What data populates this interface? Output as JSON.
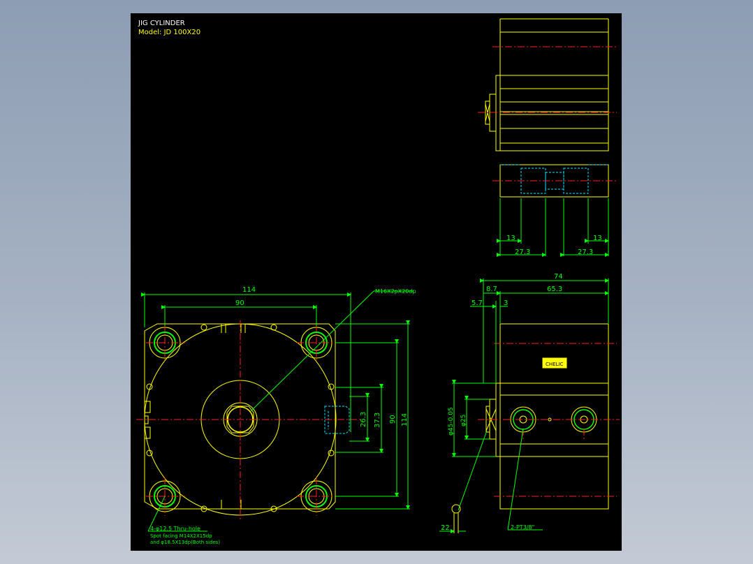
{
  "title_block": {
    "title": "JIG CYLINDER",
    "model": "Model: JD 100X20"
  },
  "colors": {
    "sheet": "#000000",
    "outline": "#ffff00",
    "dimension": "#00ff00",
    "centerline": "#ff2020",
    "hidden": "#00e5ff"
  },
  "front_view": {
    "dim_114_h": "114",
    "dim_90_h": "90",
    "dim_90_v": "90",
    "dim_114_v": "114",
    "dim_37_3": "37.3",
    "dim_26_3": "26.3",
    "callout_thread": "M16X2pX20dp",
    "hole_note_1": "4-φ12.5 Thru-hole",
    "hole_note_2": "Spot facing  M14X2X15dp",
    "hole_note_3": "and φ18.5X13dp(Both sides)"
  },
  "top_view": {
    "dim_13_left": "13",
    "dim_13_right": "13",
    "dim_27_3_left": "27.3",
    "dim_27_3_right": "27.3"
  },
  "side_view": {
    "dim_74": "74",
    "dim_8_7": "8.7",
    "dim_65_3": "65.3",
    "dim_5_7": "5.7",
    "dim_3": "3",
    "dim_phi45": "φ45-0.05",
    "dim_phi25": "φ25",
    "dim_22": "22",
    "port_note": "2-PT3/8\"",
    "label_plate": "CHELIC"
  }
}
